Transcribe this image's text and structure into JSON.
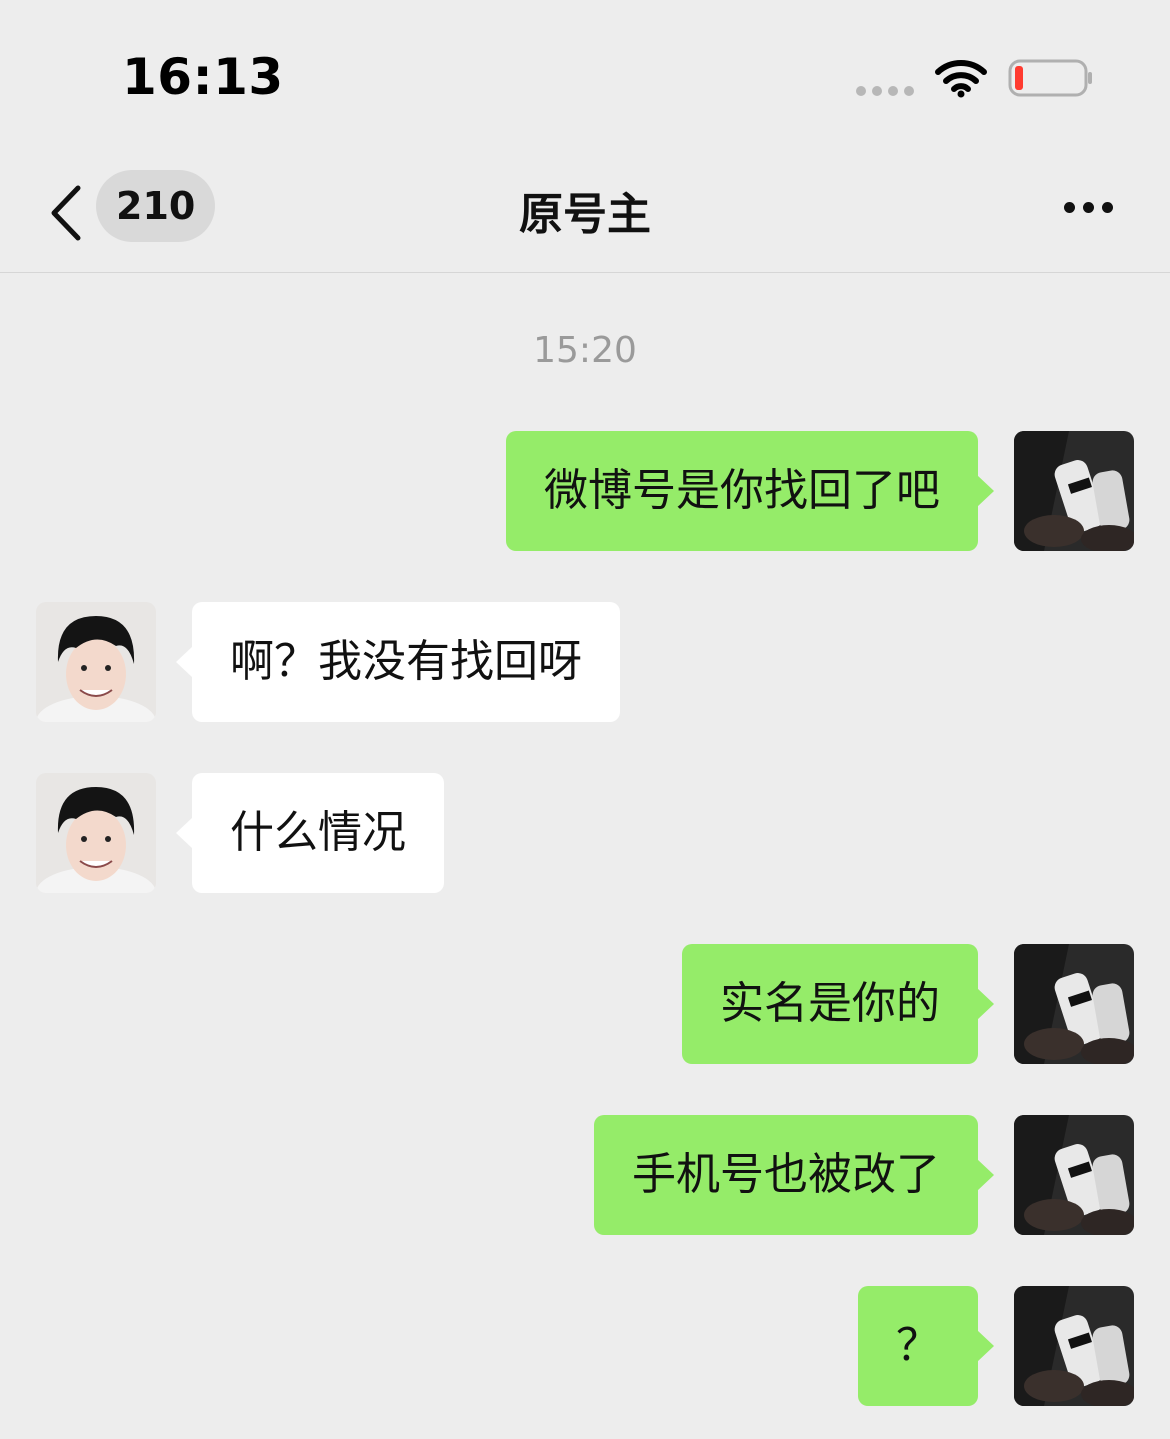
{
  "status_bar": {
    "time": "16:13",
    "icons": [
      "signal-dots-icon",
      "wifi-icon",
      "battery-low-icon"
    ],
    "battery_color": "#ff3b30"
  },
  "nav": {
    "back_icon": "chevron-left-icon",
    "unread_count": "210",
    "title": "原号主",
    "more_icon": "more-dots-icon"
  },
  "chat": {
    "timestamp": "15:20",
    "messages": [
      {
        "side": "right",
        "text": "微博号是你找回了吧"
      },
      {
        "side": "left",
        "text": "啊？我没有找回呀"
      },
      {
        "side": "left",
        "text": "什么情况"
      },
      {
        "side": "right",
        "text": "实名是你的"
      },
      {
        "side": "right",
        "text": "手机号也被改了"
      },
      {
        "side": "right",
        "text": "？"
      }
    ]
  },
  "colors": {
    "background": "#ededed",
    "outgoing_bubble": "#95ec69",
    "incoming_bubble": "#ffffff"
  }
}
